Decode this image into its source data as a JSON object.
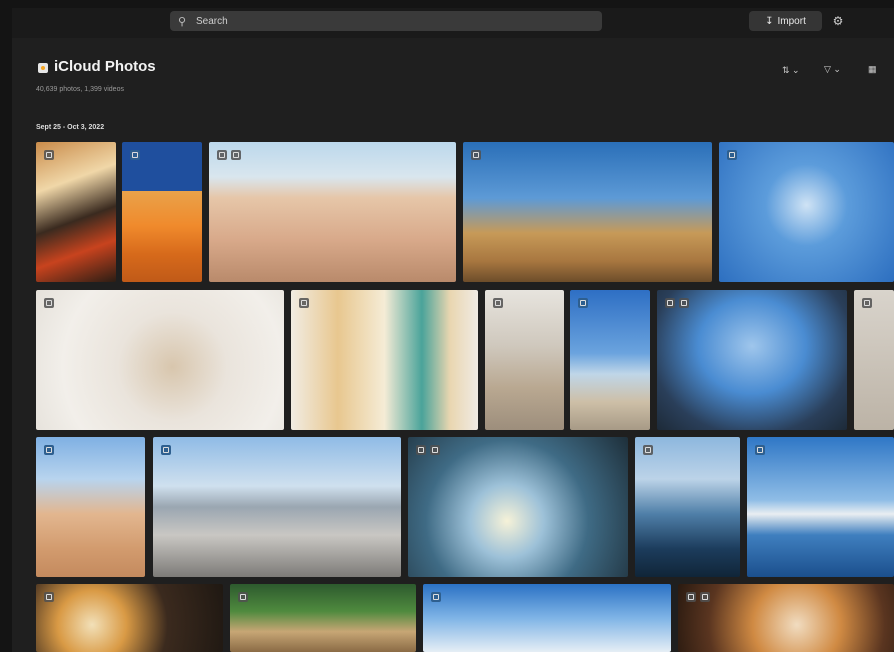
{
  "search": {
    "placeholder": "Search",
    "icon": "search-icon"
  },
  "toolbar": {
    "import_label": "Import",
    "import_icon": "import-icon",
    "settings_icon": "gear-icon"
  },
  "library": {
    "title": "iCloud Photos",
    "subtitle": "40,639 photos, 1,399 videos",
    "sort_icon": "sort-icon",
    "filter_icon": "filter-icon",
    "view_icon": "grid-icon"
  },
  "section": {
    "date_range": "Sept 25 - Oct 3, 2022"
  },
  "photos": [
    {
      "name": "photo-breakfast-table"
    },
    {
      "name": "photo-orange-circle-wall"
    },
    {
      "name": "photo-desert-rocks-person"
    },
    {
      "name": "photo-joshua-tree"
    },
    {
      "name": "photo-swing-ride"
    },
    {
      "name": "photo-dog-on-chair"
    },
    {
      "name": "photo-pizza-and-latte"
    },
    {
      "name": "photo-dog-on-street"
    },
    {
      "name": "photo-bikes-on-beach"
    },
    {
      "name": "photo-eiffel-tower"
    },
    {
      "name": "photo-edge-partial"
    },
    {
      "name": "photo-dune-hiker"
    },
    {
      "name": "photo-city-mountains"
    },
    {
      "name": "photo-forest-sunrays"
    },
    {
      "name": "photo-sea-rocks"
    },
    {
      "name": "photo-lake-shore"
    },
    {
      "name": "photo-ramen-bowl"
    },
    {
      "name": "photo-dog-in-grass"
    },
    {
      "name": "photo-sky-clouds"
    },
    {
      "name": "photo-dessert-plate"
    }
  ]
}
